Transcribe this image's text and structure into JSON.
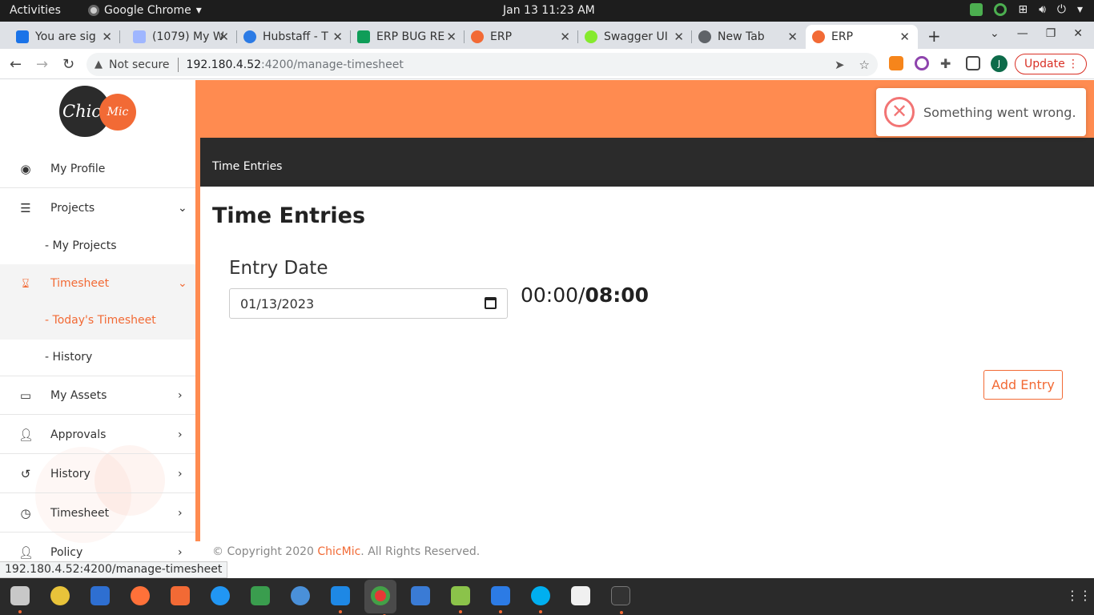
{
  "system": {
    "activities": "Activities",
    "app_name": "Google Chrome",
    "clock": "Jan 13  11:23 AM"
  },
  "tabs": [
    {
      "title": "You are sig",
      "color": "#1a73e8"
    },
    {
      "title": "(1079) My W",
      "color": "#9fb6ff"
    },
    {
      "title": "Hubstaff - T",
      "color": "#2c7be5"
    },
    {
      "title": "ERP BUG RE",
      "color": "#0f9d58"
    },
    {
      "title": "ERP",
      "color": "#f26a35"
    },
    {
      "title": "Swagger UI",
      "color": "#85ea2d"
    },
    {
      "title": "New Tab",
      "color": "#5f6368"
    },
    {
      "title": "ERP",
      "color": "#f26a35"
    }
  ],
  "omnibox": {
    "security": "Not secure",
    "host": "192.180.4.52",
    "path": ":4200/manage-timesheet"
  },
  "browser": {
    "update_label": "Update",
    "profile_initial": "J",
    "status_url": "192.180.4.52:4200/manage-timesheet"
  },
  "logo": {
    "left": "Chic",
    "right": "Mic"
  },
  "sidebar": {
    "items": [
      {
        "label": "My Profile",
        "icon": "user-circle-icon"
      },
      {
        "label": "Projects",
        "icon": "projects-icon"
      },
      {
        "label": "My Projects"
      },
      {
        "label": "Timesheet",
        "icon": "hourglass-icon"
      },
      {
        "label": "Today's Timesheet"
      },
      {
        "label": "History"
      },
      {
        "label": "My Assets",
        "icon": "laptop-icon"
      },
      {
        "label": "Approvals",
        "icon": "user-plus-icon"
      },
      {
        "label": "History",
        "icon": "history-icon"
      },
      {
        "label": "Timesheet",
        "icon": "clock-icon"
      },
      {
        "label": "Policy",
        "icon": "user-plus-icon"
      }
    ]
  },
  "header": {
    "breadcrumb": "Time Entries"
  },
  "main": {
    "title": "Time Entries",
    "entry_date_label": "Entry Date",
    "entry_date_value": "01/13/2023",
    "hours_logged": "00:00/",
    "hours_total": "08:00",
    "add_entry_label": "Add Entry"
  },
  "footer": {
    "prefix": "© Copyright 2020 ",
    "brand": "ChicMic",
    "suffix": ". All Rights Reserved."
  },
  "toast": {
    "message": "Something went wrong."
  },
  "colors": {
    "accent": "#ff8b50",
    "brand": "#f26a35",
    "dark_header": "#2b2b2b"
  }
}
